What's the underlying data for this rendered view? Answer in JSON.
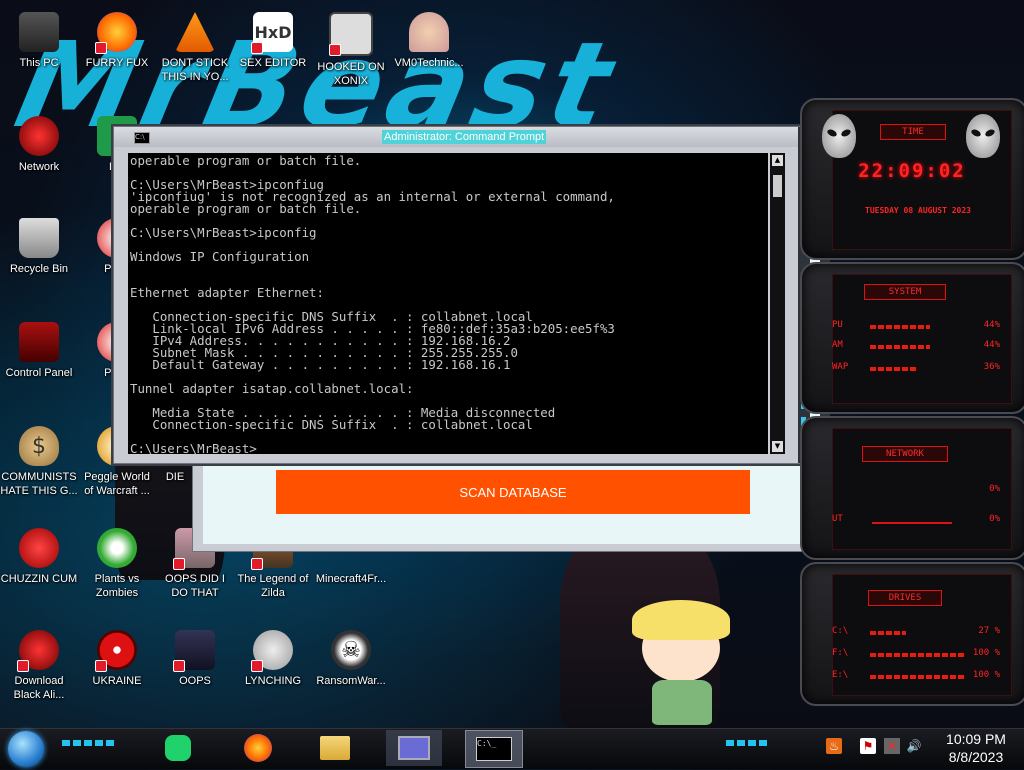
{
  "desktop": {
    "icons": [
      {
        "label": "This PC"
      },
      {
        "label": "FURRY FUX"
      },
      {
        "label": "DONT STICK THIS IN YO..."
      },
      {
        "label": "SEX EDITOR"
      },
      {
        "label": "HOOKED ON XONIX"
      },
      {
        "label": "VM0Technic..."
      },
      {
        "label": "Network"
      },
      {
        "label": "DU"
      },
      {
        "label": "Recycle Bin"
      },
      {
        "label": "Pegg"
      },
      {
        "label": "Control Panel"
      },
      {
        "label": "Pegg"
      },
      {
        "label": "COMMUNISTS HATE THIS G..."
      },
      {
        "label": "Peggle World of Warcraft ..."
      },
      {
        "label": "DIE"
      },
      {
        "label": "CHUZZIN CUM"
      },
      {
        "label": "Plants vs Zombies"
      },
      {
        "label": "OOPS DID I DO THAT"
      },
      {
        "label": "The Legend of Zilda"
      },
      {
        "label": "Minecraft4Fr..."
      },
      {
        "label": "Download Black Ali..."
      },
      {
        "label": "UKRAINE"
      },
      {
        "label": "OOPS"
      },
      {
        "label": "LYNCHING"
      },
      {
        "label": "RansomWar..."
      }
    ],
    "wallpaper_text": "MrBeast"
  },
  "cmd": {
    "title": "Administrator: Command Prompt",
    "lines": "operable program or batch file.\n\nC:\\Users\\MrBeast>ipconfiug\n'ipconfiug' is not recognized as an internal or external command,\noperable program or batch file.\n\nC:\\Users\\MrBeast>ipconfig\n\nWindows IP Configuration\n\n\nEthernet adapter Ethernet:\n\n   Connection-specific DNS Suffix  . : collabnet.local\n   Link-local IPv6 Address . . . . . : fe80::def:35a3:b205:ee5f%3\n   IPv4 Address. . . . . . . . . . . : 192.168.16.2\n   Subnet Mask . . . . . . . . . . . : 255.255.255.0\n   Default Gateway . . . . . . . . . : 192.168.16.1\n\nTunnel adapter isatap.collabnet.local:\n\n   Media State . . . . . . . . . . . : Media disconnected\n   Connection-specific DNS Suffix  . : collabnet.local\n\nC:\\Users\\MrBeast>"
  },
  "scan_app": {
    "button_label": "SCAN DATABASE",
    "button_color": "#ff5100"
  },
  "gadgets": {
    "time": {
      "title": "TIME",
      "clock": "22:09:02",
      "date": "TUESDAY 08 AUGUST 2023"
    },
    "system": {
      "title": "SYSTEM",
      "rows": [
        {
          "label": "PU",
          "value": "44%",
          "level": 0.44
        },
        {
          "label": "AM",
          "value": "44%",
          "level": 0.44
        },
        {
          "label": "WAP",
          "value": "36%",
          "level": 0.36
        }
      ]
    },
    "network": {
      "title": "NETWORK",
      "rows": [
        {
          "label": "",
          "value": "0%"
        },
        {
          "label": "UT",
          "value": "0%"
        }
      ]
    },
    "drives": {
      "title": "DRIVES",
      "rows": [
        {
          "label": "C:\\",
          "value": "27 %",
          "level": 0.27
        },
        {
          "label": "F:\\",
          "value": "100 %",
          "level": 1.0
        },
        {
          "label": "E:\\",
          "value": "100 %",
          "level": 1.0
        }
      ]
    },
    "accent": "#ff2424"
  },
  "taskbar": {
    "clock_time": "10:09 PM",
    "clock_date": "8/8/2023",
    "pinned": [
      {
        "icon": "chat-app-icon"
      },
      {
        "icon": "firefox-icon"
      },
      {
        "icon": "file-explorer-icon"
      },
      {
        "icon": "app-window-icon"
      },
      {
        "icon": "command-prompt-icon"
      }
    ],
    "tray": [
      {
        "icon": "java-icon"
      },
      {
        "icon": "security-flag-icon"
      },
      {
        "icon": "network-disconnected-icon"
      },
      {
        "icon": "volume-icon"
      }
    ]
  }
}
